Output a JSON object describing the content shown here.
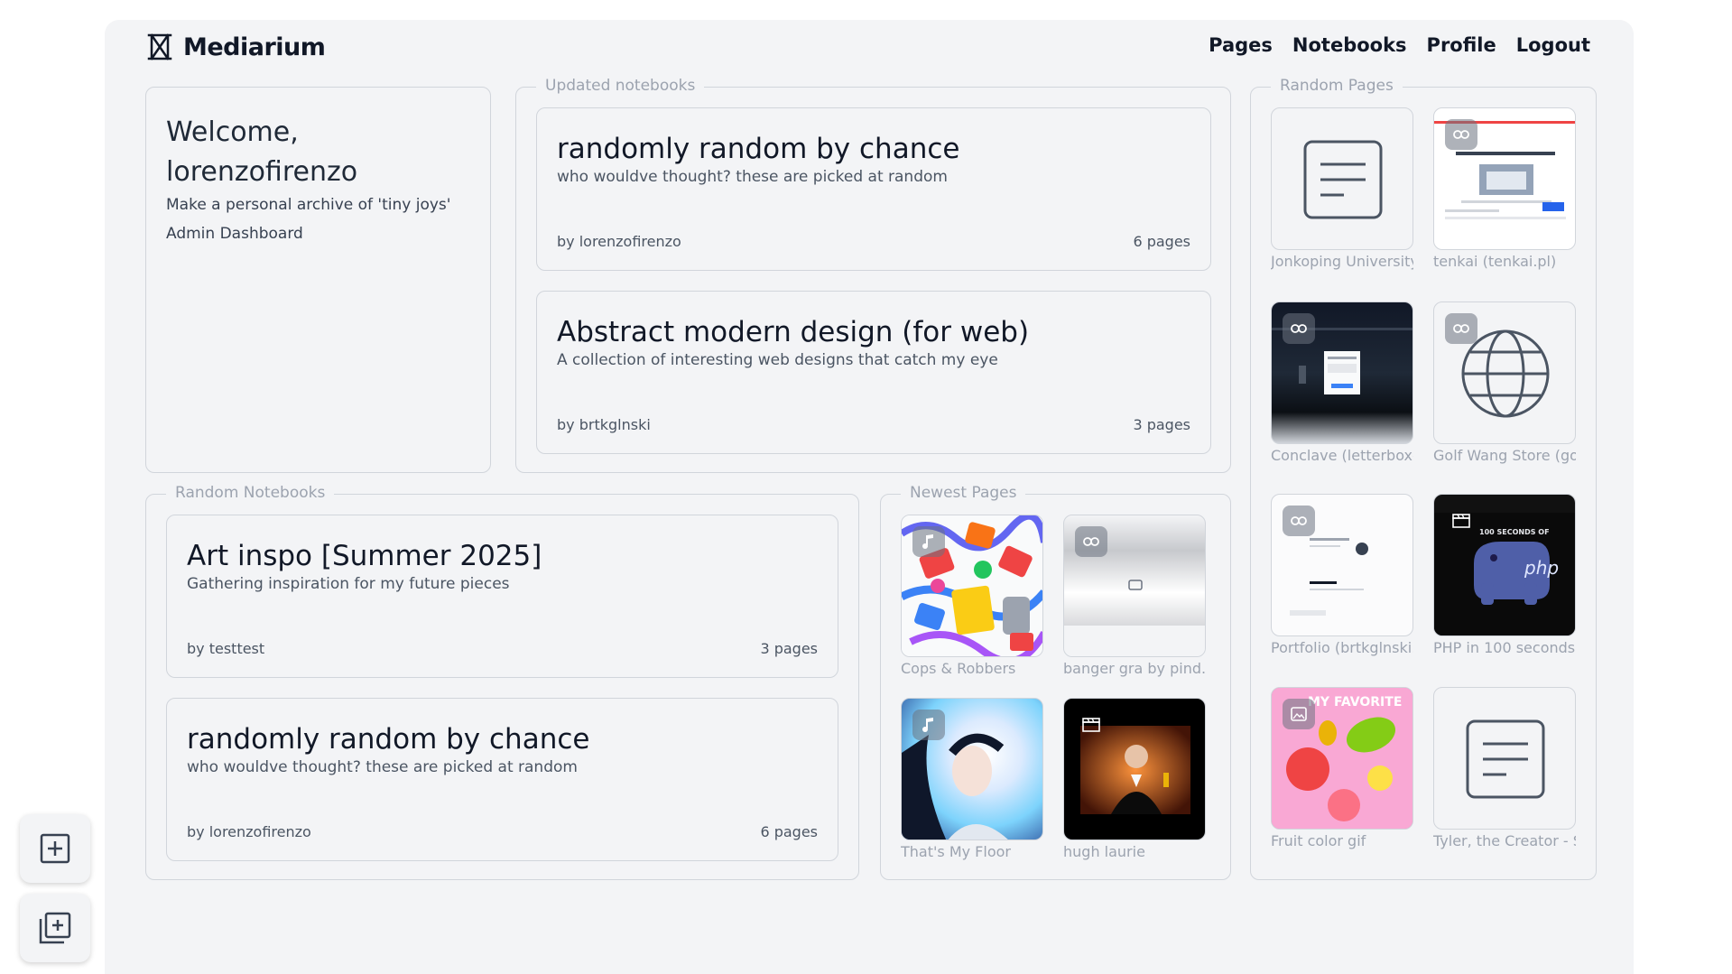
{
  "brand": {
    "name": "Mediarium"
  },
  "nav": {
    "pages": "Pages",
    "notebooks": "Notebooks",
    "profile": "Profile",
    "logout": "Logout"
  },
  "welcome": {
    "greeting": "Welcome,",
    "username": "lorenzofirenzo",
    "tagline": "Make a personal archive of 'tiny joys'",
    "admin_link": "Admin Dashboard"
  },
  "updated_notebooks": {
    "legend": "Updated notebooks",
    "items": [
      {
        "title": "randomly random by chance",
        "description": "who wouldve thought? these are picked at random",
        "author": "by lorenzofirenzo",
        "pages": "6 pages"
      },
      {
        "title": "Abstract modern design (for web)",
        "description": "A collection of interesting web designs that catch my eye",
        "author": "by brtkglnski",
        "pages": "3 pages"
      }
    ]
  },
  "random_notebooks": {
    "legend": "Random Notebooks",
    "items": [
      {
        "title": "Art inspo [Summer 2025]",
        "description": "Gathering inspiration for my future pieces",
        "author": "by testtest",
        "pages": "3 pages"
      },
      {
        "title": "randomly random by chance",
        "description": "who wouldve thought? these are picked at random",
        "author": "by lorenzofirenzo",
        "pages": "6 pages"
      }
    ]
  },
  "newest_pages": {
    "legend": "Newest Pages",
    "items": [
      {
        "caption": "Cops & Robbers",
        "badge": "music-note-icon"
      },
      {
        "caption": "banger gra by pind.vs",
        "badge": "link-icon"
      },
      {
        "caption": "That's My Floor",
        "badge": "music-note-icon"
      },
      {
        "caption": "hugh laurie",
        "badge": "clapperboard-icon"
      }
    ]
  },
  "random_pages": {
    "legend": "Random Pages",
    "items": [
      {
        "caption": "Jonkoping University",
        "badge": "document-icon"
      },
      {
        "caption": "tenkai (tenkai.pl)",
        "badge": "link-icon"
      },
      {
        "caption": "Conclave (letterboxd.com)",
        "badge": "link-icon"
      },
      {
        "caption": "Golf Wang Store (golfwang.com)",
        "badge": "link-icon"
      },
      {
        "caption": "Portfolio (brtkglnski.github.io)",
        "badge": "link-icon"
      },
      {
        "caption": "PHP in 100 seconds",
        "badge": "clapperboard-icon"
      },
      {
        "caption": "Fruit color gif",
        "badge": "image-icon"
      },
      {
        "caption": "Tyler, the Creator - Sessions",
        "badge": "document-icon"
      }
    ],
    "php_thumb_text": "100 SECONDS OF",
    "php_logo_text": "php",
    "fruit_thumb_text": "MY FAVORITE"
  },
  "colors": {
    "background": "#f3f4f6",
    "border": "#d1d5db",
    "text": "#111827",
    "muted": "#9ca3af"
  }
}
